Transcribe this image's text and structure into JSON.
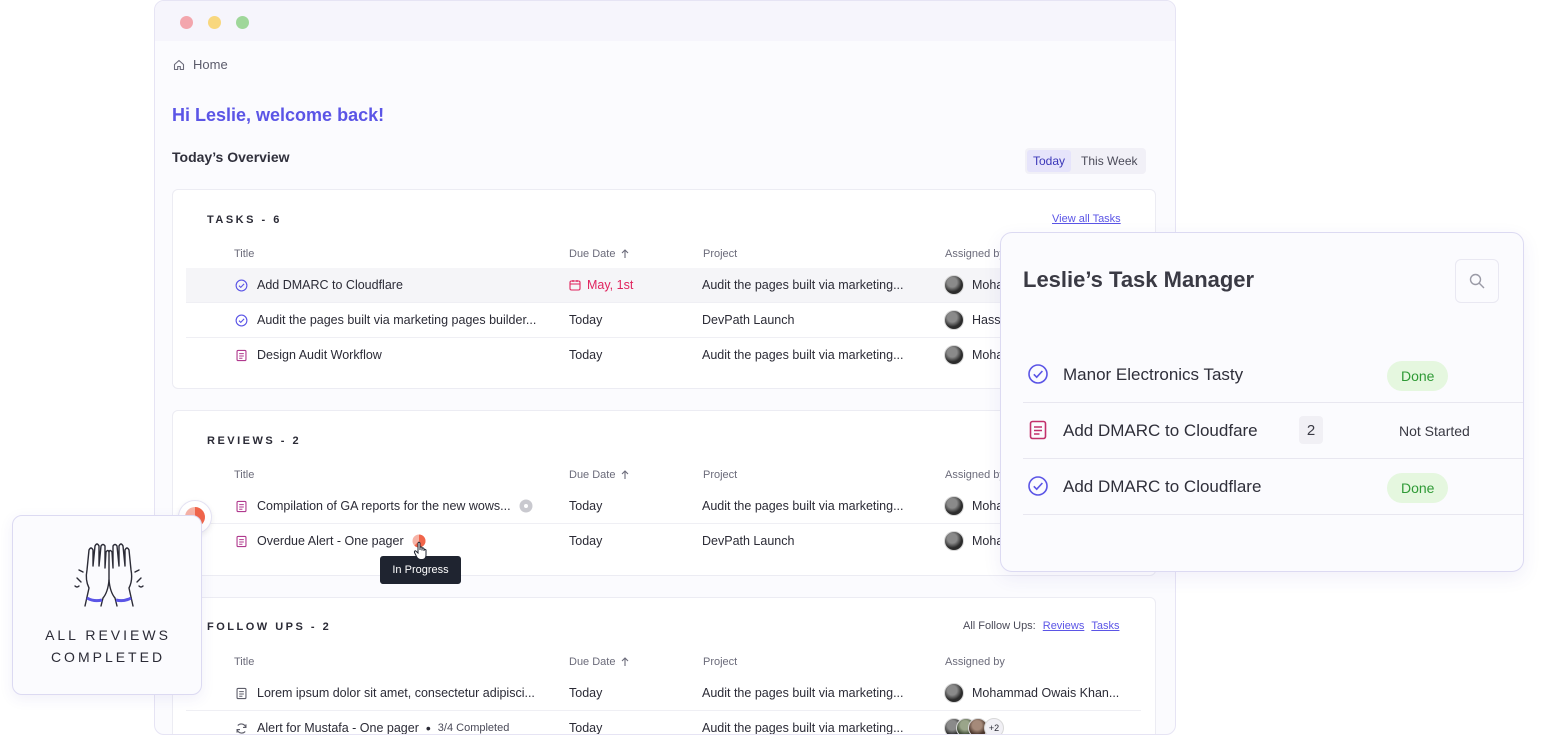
{
  "breadcrumb": {
    "label": "Home"
  },
  "greeting": "Hi Leslie, welcome back!",
  "overview": {
    "title": "Today’s Overview",
    "toggle": {
      "today": "Today",
      "this_week": "This Week",
      "active": "Today"
    }
  },
  "columns": {
    "title": "Title",
    "due_date": "Due Date",
    "project": "Project",
    "assigned_by": "Assigned by"
  },
  "tasks": {
    "heading": "TASKS - 6",
    "link": "View all Tasks",
    "rows": [
      {
        "title": "Add DMARC to Cloudflare",
        "due": "May, 1st",
        "project": "Audit the pages built via marketing...",
        "assignee": "Moha",
        "icon": "check-circle-icon"
      },
      {
        "title": "Audit the pages built via marketing pages builder...",
        "due": "Today",
        "project": "DevPath Launch",
        "assignee": "Hass",
        "icon": "check-circle-icon"
      },
      {
        "title": "Design Audit Workflow",
        "due": "Today",
        "project": "Audit the pages built via marketing...",
        "assignee": "Moha",
        "icon": "document-icon"
      }
    ]
  },
  "reviews": {
    "heading": "REVIEWS - 2",
    "rows": [
      {
        "title": "Compilation of GA reports for the new wows...",
        "due": "Today",
        "project": "Audit the pages built via marketing...",
        "assignee": "Moha",
        "icon": "document-icon",
        "status_icon": "not-started-icon"
      },
      {
        "title": "Overdue Alert - One pager",
        "due": "Today",
        "project": "DevPath Launch",
        "assignee": "Moha",
        "icon": "document-icon",
        "status_icon": "in-progress-icon"
      }
    ],
    "tooltip": "In Progress"
  },
  "follow_ups": {
    "heading": "FOLLOW UPS - 2",
    "filter_label": "All  Follow Ups:",
    "filter_reviews": "Reviews",
    "filter_tasks": "Tasks",
    "rows": [
      {
        "title": "Lorem ipsum dolor sit amet, consectetur adipisci...",
        "due": "Today",
        "project": "Audit the pages built via marketing...",
        "assignee": "Mohammad Owais Khan...",
        "icon": "document-icon"
      },
      {
        "title": "Alert for Mustafa - One pager",
        "meta": "3/4 Completed",
        "due": "Today",
        "project": "Audit the pages built via marketing...",
        "assignee_extra": "+2",
        "icon": "refresh-icon"
      }
    ]
  },
  "task_manager": {
    "title": "Leslie’s Task Manager",
    "items": [
      {
        "label": "Manor Electronics Tasty",
        "status": "Done",
        "icon": "check-circle-icon"
      },
      {
        "label": "Add DMARC to Cloudfare",
        "count": "2",
        "status": "Not Started",
        "icon": "document-icon"
      },
      {
        "label": "Add DMARC to Cloudflare",
        "status": "Done",
        "icon": "check-circle-icon"
      }
    ]
  },
  "reviews_badge": {
    "line1": "ALL REVIEWS",
    "line2": "COMPLETED"
  },
  "colors": {
    "accent": "#5b55e6",
    "danger": "#e0245e",
    "done_bg": "#e5f7df",
    "done_text": "#2f9a36",
    "doc_icon": "#b03a8e",
    "progress": "#f0654a"
  }
}
